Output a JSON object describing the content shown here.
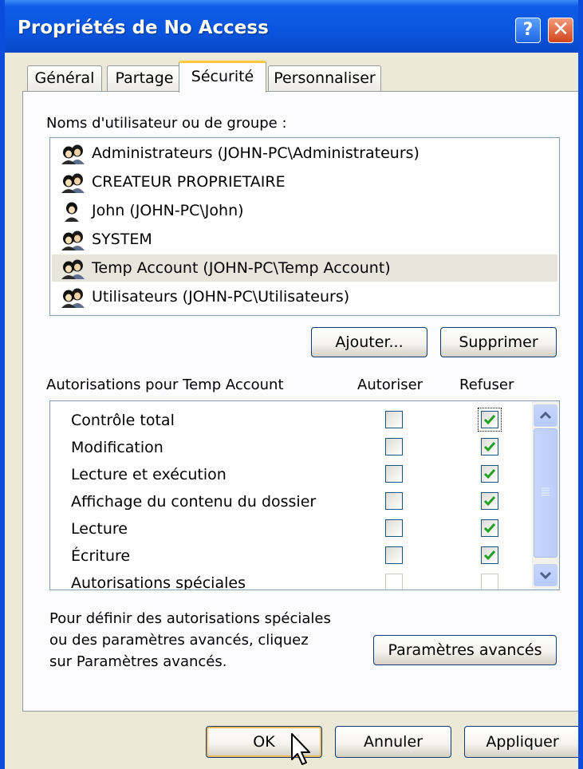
{
  "window": {
    "title": "Propriétés de No Access",
    "help": "?",
    "close": "✕"
  },
  "tabs": [
    {
      "label": "Général",
      "active": false
    },
    {
      "label": "Partage",
      "active": false
    },
    {
      "label": "Sécurité",
      "active": true
    },
    {
      "label": "Personnaliser",
      "active": false
    }
  ],
  "users": {
    "label": "Noms d'utilisateur ou de groupe :",
    "items": [
      {
        "name": "Administrateurs (JOHN-PC\\Administrateurs)",
        "icon": "group-icon",
        "selected": false
      },
      {
        "name": "CREATEUR PROPRIETAIRE",
        "icon": "group-icon",
        "selected": false
      },
      {
        "name": "John (JOHN-PC\\John)",
        "icon": "user-icon",
        "selected": false
      },
      {
        "name": "SYSTEM",
        "icon": "group-icon",
        "selected": false
      },
      {
        "name": "Temp Account (JOHN-PC\\Temp Account)",
        "icon": "group-icon",
        "selected": true
      },
      {
        "name": "Utilisateurs (JOHN-PC\\Utilisateurs)",
        "icon": "group-icon",
        "selected": false
      }
    ],
    "add_button": "Ajouter...",
    "remove_button": "Supprimer"
  },
  "permissions": {
    "label": "Autorisations pour Temp Account",
    "allow_header": "Autoriser",
    "deny_header": "Refuser",
    "rows": [
      {
        "name": "Contrôle total",
        "allow": false,
        "deny": true,
        "enabled": true
      },
      {
        "name": "Modification",
        "allow": false,
        "deny": true,
        "enabled": true
      },
      {
        "name": "Lecture et exécution",
        "allow": false,
        "deny": true,
        "enabled": true
      },
      {
        "name": "Affichage du contenu du dossier",
        "allow": false,
        "deny": true,
        "enabled": true
      },
      {
        "name": "Lecture",
        "allow": false,
        "deny": true,
        "enabled": true
      },
      {
        "name": "Écriture",
        "allow": false,
        "deny": true,
        "enabled": true
      },
      {
        "name": "Autorisations spéciales",
        "allow": false,
        "deny": false,
        "enabled": false
      }
    ]
  },
  "advanced": {
    "text_lines": [
      "Pour définir des autorisations spéciales",
      "ou des paramètres avancés, cliquez",
      "sur Paramètres avancés."
    ],
    "button": "Paramètres avancés"
  },
  "footer": {
    "ok": "OK",
    "cancel": "Annuler",
    "apply": "Appliquer"
  },
  "colors": {
    "titlebar": "#0A56E0",
    "face": "#ECE9D8",
    "checkmark": "#21A121",
    "selected_row": "#E8E5DC"
  }
}
